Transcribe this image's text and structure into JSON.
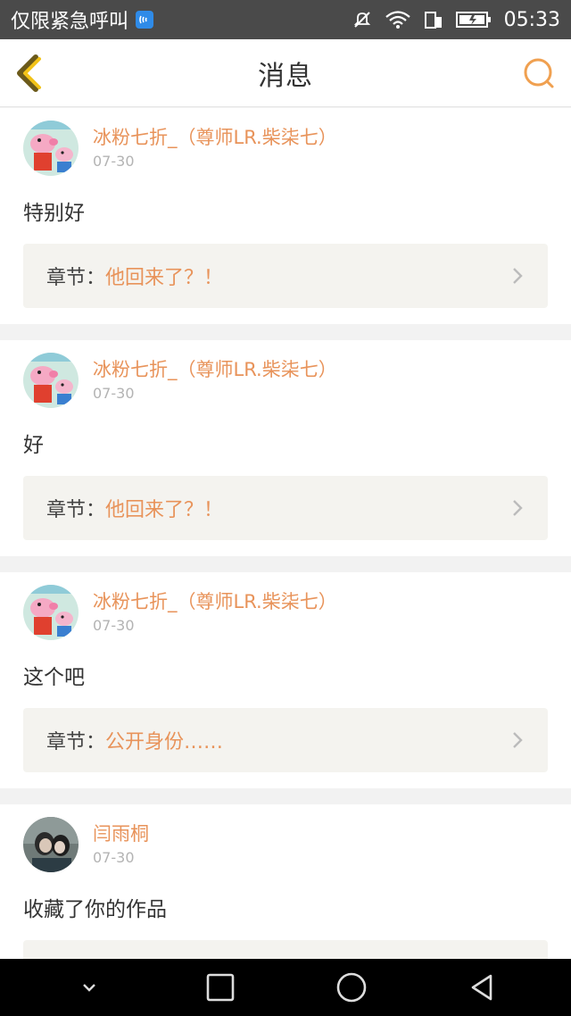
{
  "status_bar": {
    "carrier": "仅限紧急呼叫",
    "time": "05:33",
    "icons": [
      "nfc-icon",
      "mute-icon",
      "wifi-icon",
      "sim-icon",
      "battery-icon"
    ]
  },
  "header": {
    "title": "消息",
    "back_icon": "back-chevron-icon",
    "search_icon": "search-icon",
    "accent_color": "#f0a050"
  },
  "feed": {
    "chapter_prefix": "章节：",
    "items": [
      {
        "username": "冰粉七折_（尊师LR.柴柒七）",
        "date": "07-30",
        "message": "特别好",
        "chapter": "他回来了？！",
        "avatar": "peppa-pig-avatar"
      },
      {
        "username": "冰粉七折_（尊师LR.柴柒七）",
        "date": "07-30",
        "message": "好",
        "chapter": "他回来了？！",
        "avatar": "peppa-pig-avatar"
      },
      {
        "username": "冰粉七折_（尊师LR.柴柒七）",
        "date": "07-30",
        "message": "这个吧",
        "chapter": "公开身份……",
        "avatar": "peppa-pig-avatar"
      },
      {
        "username": "闫雨桐",
        "date": "07-30",
        "message": "收藏了你的作品",
        "avatar": "photo-avatar"
      }
    ]
  },
  "nav_bar": {
    "icons": [
      "chevron-down-icon",
      "recent-apps-icon",
      "home-icon",
      "back-icon"
    ]
  },
  "colors": {
    "username": "#e8935a",
    "chapter_title": "#e8935a",
    "chapter_bg": "#f4f3ef",
    "status_bar_bg": "#4a4a4a",
    "nav_bar_bg": "#000000"
  }
}
